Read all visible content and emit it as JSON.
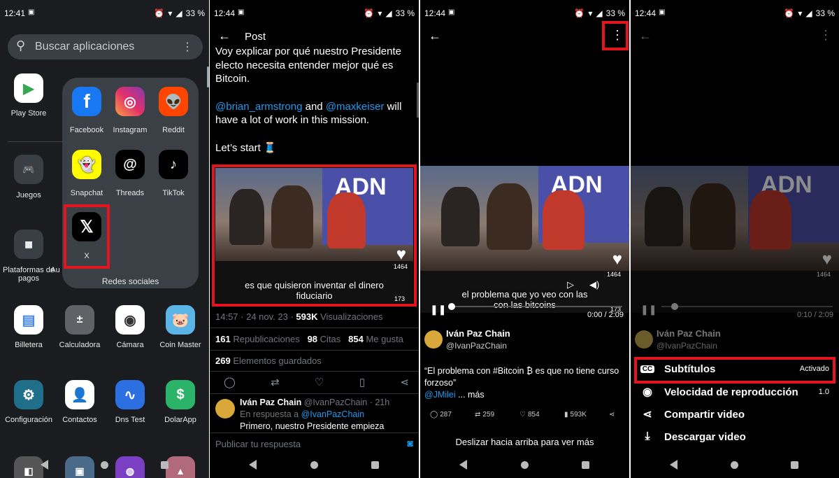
{
  "panel1": {
    "status": {
      "time": "12:41",
      "battery": "33 %"
    },
    "search_placeholder": "Buscar aplicaciones",
    "apps": [
      {
        "label": "Play Store"
      },
      {
        "label": "Juegos"
      },
      {
        "label": "Plataformas de pagos"
      },
      {
        "label": "Au"
      },
      {
        "label": "Billetera"
      },
      {
        "label": "Calculadora"
      },
      {
        "label": "Cámara"
      },
      {
        "label": "Coin Master"
      },
      {
        "label": "Configuración"
      },
      {
        "label": "Contactos"
      },
      {
        "label": "Dns Test"
      },
      {
        "label": "DolarApp"
      }
    ],
    "folder": {
      "title": "Redes sociales",
      "apps": [
        {
          "label": "Facebook"
        },
        {
          "label": "Instagram"
        },
        {
          "label": "Reddit"
        },
        {
          "label": "Snapchat"
        },
        {
          "label": "Threads"
        },
        {
          "label": "TikTok"
        },
        {
          "label": "X"
        }
      ]
    }
  },
  "panel2": {
    "status": {
      "time": "12:44",
      "battery": "33 %"
    },
    "header_title": "Post",
    "text_lines": [
      "Voy explicar por qué nuestro Presidente",
      "electo necesita entender mejor qué es",
      "Bitcoin."
    ],
    "mention1": "@brian_armstrong",
    "and_text": "and",
    "mention2": "@maxkeiser",
    "will_text": "will",
    "line_work": "have a lot of work in this mission.",
    "lets_start": "Let’s start 🧵",
    "video_subtitle": "es que quisieron inventar el dinero fiduciario",
    "video_likes": "1464",
    "video_comments": "173",
    "meta_time": "14:57 · 24 nov. 23 ·",
    "meta_views": "593K",
    "meta_views_label": "Visualizaciones",
    "reposts_num": "161",
    "reposts_label": "Republicaciones",
    "quotes_num": "98",
    "quotes_label": "Citas",
    "likes_num": "854",
    "likes_label": "Me gusta",
    "saved_num": "269",
    "saved_label": "Elementos guardados",
    "reply_name": "Iván Paz Chain",
    "reply_handle": "@IvanPazChain · 21h",
    "reply_to": "En respuesta a",
    "reply_to_handle": "@IvanPazChain",
    "reply_text": "Primero, nuestro Presidente empieza",
    "reply_placeholder": "Publicar tu respuesta"
  },
  "panel3": {
    "status": {
      "time": "12:44",
      "battery": "33 %"
    },
    "video_subtitle": "el problema que yo veo con las con las bitcoins",
    "video_likes": "1464",
    "video_comments": "173",
    "video_time": "0:00 / 2:09",
    "author_name": "Iván Paz Chain",
    "author_handle": "@IvanPazChain",
    "tweet_text": "“El problema con #Bitcoin ₿  es que no tiene curso forzoso”",
    "tweet_mention": "@JMilei",
    "tweet_more": "... más",
    "replies": "287",
    "reposts": "259",
    "likes": "854",
    "views": "593K",
    "swipe_text": "Deslizar hacia arriba para ver más"
  },
  "panel4": {
    "status": {
      "time": "12:44",
      "battery": "33 %"
    },
    "video_likes": "1464",
    "video_time": "0:10 / 2:09",
    "author_name": "Iván Paz Chain",
    "author_handle": "@IvanPazChain",
    "menu": [
      {
        "label": "Subtítulos",
        "value": "Activado",
        "icon": "cc-icon"
      },
      {
        "label": "Velocidad de reproducción",
        "value": "1.0",
        "icon": "play-circle-icon"
      },
      {
        "label": "Compartir video",
        "value": "",
        "icon": "share-icon"
      },
      {
        "label": "Descargar video",
        "value": "",
        "icon": "download-icon"
      }
    ]
  },
  "colors": {
    "highlight": "#e3141e",
    "link": "#1d9bf0"
  }
}
